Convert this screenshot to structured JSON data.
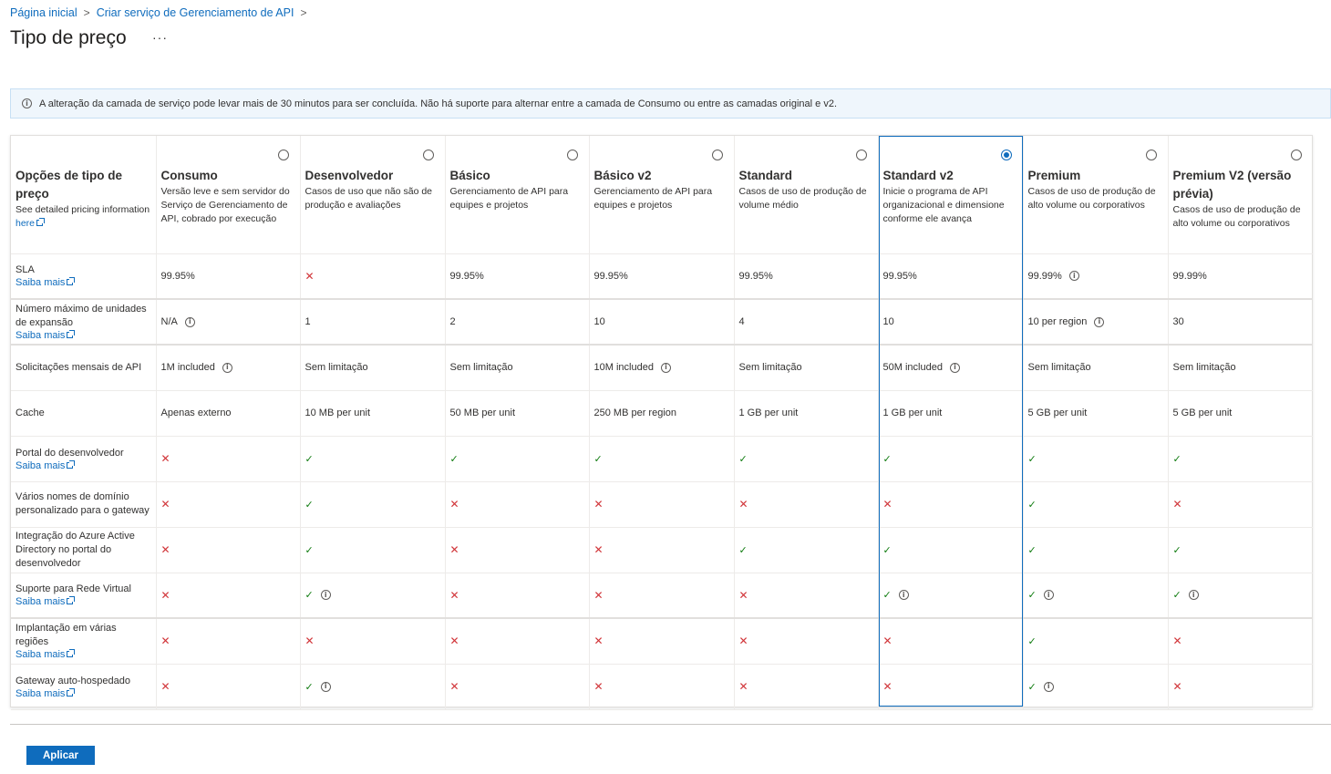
{
  "breadcrumb": [
    "Página inicial",
    "Criar serviço de Gerenciamento de API"
  ],
  "page_title": "Tipo de preço",
  "more_label": "···",
  "banner": "A alteração da camada de serviço pode levar mais de 30 minutos para ser concluída. Não há suporte para alternar entre a camada de Consumo ou entre as camadas original e v2.",
  "header_label": {
    "title": "Opções de tipo de preço",
    "desc": "See detailed pricing information",
    "link": "here"
  },
  "tiers": [
    {
      "name": "Consumo",
      "desc": "Versão leve e sem servidor do Serviço de Gerenciamento de API, cobrado por execução",
      "selected": false
    },
    {
      "name": "Desenvolvedor",
      "desc": "Casos de uso que não são de produção e avaliações",
      "selected": false
    },
    {
      "name": "Básico",
      "desc": "Gerenciamento de API para equipes e projetos",
      "selected": false
    },
    {
      "name": "Básico v2",
      "desc": "Gerenciamento de API para equipes e projetos",
      "selected": false
    },
    {
      "name": "Standard",
      "desc": "Casos de uso de produção de volume médio",
      "selected": false
    },
    {
      "name": "Standard v2",
      "desc": "Inicie o programa de API organizacional e dimensione conforme ele avança",
      "selected": true
    },
    {
      "name": "Premium",
      "desc": "Casos de uso de produção de alto volume ou corporativos",
      "selected": false
    },
    {
      "name": "Premium V2 (versão prévia)",
      "desc": "Casos de uso de produção de alto volume ou corporativos",
      "selected": false
    }
  ],
  "learn_more": "Saiba mais",
  "features": [
    {
      "key": "sla",
      "label": "SLA",
      "learn_more": true,
      "values": [
        {
          "t": "99.95%"
        },
        {
          "x": true
        },
        {
          "t": "99.95%"
        },
        {
          "t": "99.95%"
        },
        {
          "t": "99.95%"
        },
        {
          "t": "99.95%"
        },
        {
          "t": "99.99%",
          "info": true
        },
        {
          "t": "99.99%"
        }
      ]
    },
    {
      "key": "scale",
      "label": "Número máximo de unidades de expansão",
      "learn_more": true,
      "values": [
        {
          "t": "N/A",
          "info": true
        },
        {
          "t": "1"
        },
        {
          "t": "2"
        },
        {
          "t": "10"
        },
        {
          "t": "4"
        },
        {
          "t": "10"
        },
        {
          "t": "10 per region",
          "info": true
        },
        {
          "t": "30"
        }
      ]
    },
    {
      "key": "req",
      "label": "Solicitações mensais de API",
      "learn_more": false,
      "values": [
        {
          "t": "1M included",
          "info": true
        },
        {
          "t": "Sem limitação"
        },
        {
          "t": "Sem limitação"
        },
        {
          "t": "10M included",
          "info": true
        },
        {
          "t": "Sem limitação"
        },
        {
          "t": "50M included",
          "info": true
        },
        {
          "t": "Sem limitação"
        },
        {
          "t": "Sem limitação"
        }
      ]
    },
    {
      "key": "cache",
      "label": "Cache",
      "learn_more": false,
      "values": [
        {
          "t": "Apenas externo"
        },
        {
          "t": "10 MB per unit"
        },
        {
          "t": "50 MB per unit"
        },
        {
          "t": "250 MB per region"
        },
        {
          "t": "1 GB per unit"
        },
        {
          "t": "1 GB per unit"
        },
        {
          "t": "5 GB per unit"
        },
        {
          "t": "5 GB per unit"
        }
      ]
    },
    {
      "key": "portal",
      "label": "Portal do desenvolvedor",
      "learn_more": true,
      "values": [
        {
          "x": true
        },
        {
          "c": true
        },
        {
          "c": true
        },
        {
          "c": true
        },
        {
          "c": true
        },
        {
          "c": true
        },
        {
          "c": true
        },
        {
          "c": true
        }
      ]
    },
    {
      "key": "domain",
      "label": "Vários nomes de domínio personalizado para o gateway",
      "learn_more": false,
      "values": [
        {
          "x": true
        },
        {
          "c": true
        },
        {
          "x": true
        },
        {
          "x": true
        },
        {
          "x": true
        },
        {
          "x": true
        },
        {
          "c": true
        },
        {
          "x": true
        }
      ]
    },
    {
      "key": "aad",
      "label": "Integração do Azure Active Directory no portal do desenvolvedor",
      "learn_more": false,
      "values": [
        {
          "x": true
        },
        {
          "c": true
        },
        {
          "x": true
        },
        {
          "x": true
        },
        {
          "c": true
        },
        {
          "c": true
        },
        {
          "c": true
        },
        {
          "c": true
        }
      ]
    },
    {
      "key": "vnet",
      "label": "Suporte para Rede Virtual",
      "learn_more": true,
      "values": [
        {
          "x": true
        },
        {
          "c": true,
          "info": true
        },
        {
          "x": true
        },
        {
          "x": true
        },
        {
          "x": true
        },
        {
          "c": true,
          "info": true
        },
        {
          "c": true,
          "info": true
        },
        {
          "c": true,
          "info": true
        }
      ]
    },
    {
      "key": "multi",
      "label": "Implantação em várias regiões",
      "learn_more": true,
      "values": [
        {
          "x": true
        },
        {
          "x": true
        },
        {
          "x": true
        },
        {
          "x": true
        },
        {
          "x": true
        },
        {
          "x": true
        },
        {
          "c": true
        },
        {
          "x": true
        }
      ]
    },
    {
      "key": "gw",
      "label": "Gateway auto-hospedado",
      "learn_more": true,
      "values": [
        {
          "x": true
        },
        {
          "c": true,
          "info": true
        },
        {
          "x": true
        },
        {
          "x": true
        },
        {
          "x": true
        },
        {
          "x": true
        },
        {
          "c": true,
          "info": true
        },
        {
          "x": true
        }
      ]
    }
  ],
  "apply_label": "Aplicar",
  "colors": {
    "accent": "#0f6cbd",
    "check": "#107c10",
    "cross": "#d13438"
  }
}
